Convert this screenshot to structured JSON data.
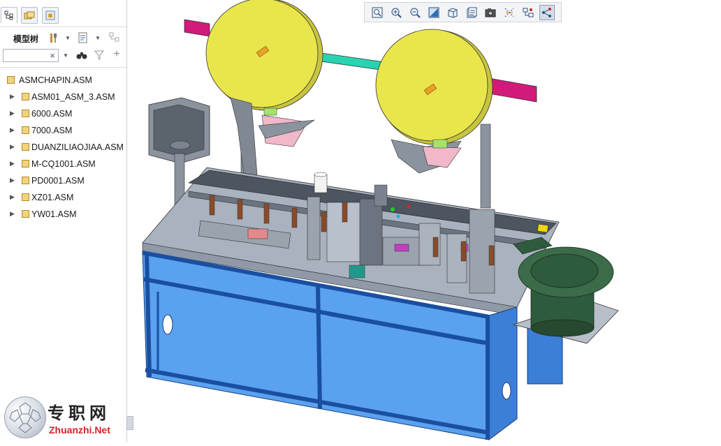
{
  "sidebar": {
    "tabs": [
      {
        "name": "model-tree-tab",
        "icon": "tree-icon"
      },
      {
        "name": "folder-browser-tab",
        "icon": "folders-icon"
      },
      {
        "name": "favorites-tab",
        "icon": "star-icon"
      }
    ],
    "title": "模型树",
    "search": {
      "value": "",
      "clear_glyph": "×"
    },
    "tree": {
      "root": "ASMCHAPIN.ASM",
      "items": [
        "ASM01_ASM_3.ASM",
        "6000.ASM",
        "7000.ASM",
        "DUANZILIAOJIAA.ASM",
        "M-CQ1001.ASM",
        "PD0001.ASM",
        "XZ01.ASM",
        "YW01.ASM"
      ]
    }
  },
  "view_toolbar": {
    "buttons": [
      "zoom-to-fit-icon",
      "zoom-in-icon",
      "zoom-out-icon",
      "repaint-icon",
      "view-orientation-icon",
      "saved-views-icon",
      "display-style-icon",
      "datum-display-icon",
      "spin-center-icon",
      "annotation-display-icon"
    ]
  },
  "watermark": {
    "cn": "专职网",
    "en": "Zhuanzhi.Net"
  },
  "colors": {
    "frame_blue": "#3c7fd6",
    "glass_blue": "#5aa2f0",
    "reel_yellow": "#e9e64c",
    "bracket_magenta": "#d21a7a",
    "bar_teal": "#27d3b0",
    "bowl_green": "#2e5a3d",
    "plate_grey": "#b8bfca"
  }
}
